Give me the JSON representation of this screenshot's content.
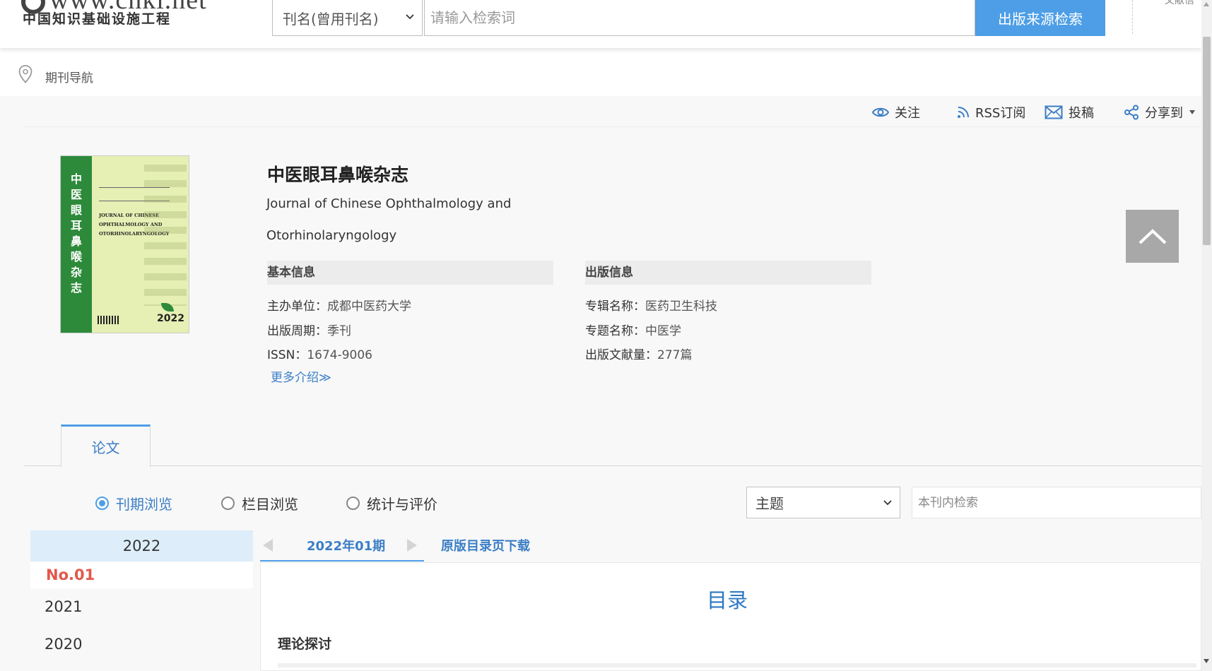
{
  "header": {
    "logo_url": "www.cnki.net",
    "logo_cn": "中国知识基础设施工程",
    "search_select": "刊名(曾用刊名)",
    "search_placeholder": "请输入检索词",
    "search_button": "出版来源检索",
    "right_text": "文献信"
  },
  "breadcrumb": {
    "label": "期刊导航"
  },
  "actions": {
    "follow": "关注",
    "rss": "RSS订阅",
    "submit": "投稿",
    "share": "分享到"
  },
  "journal": {
    "title_cn": "中医眼耳鼻喉杂志",
    "title_en": "Journal of Chinese Ophthalmology and Otorhinolaryngology",
    "cover": {
      "spine_text": "中医眼耳鼻喉杂志",
      "en_text": "JOURNAL OF CHINESE OPHTHALMOLOGY AND OTORHINOLARYNGOLOGY",
      "year": "2022"
    },
    "basic_info": {
      "heading": "基本信息",
      "rows": [
        {
          "key": "主办单位：",
          "value": "成都中医药大学"
        },
        {
          "key": "出版周期：",
          "value": "季刊"
        },
        {
          "key": "ISSN：",
          "value": "1674-9006"
        }
      ]
    },
    "pub_info": {
      "heading": "出版信息",
      "rows": [
        {
          "key": "专辑名称：",
          "value": "医药卫生科技"
        },
        {
          "key": "专题名称：",
          "value": "中医学"
        },
        {
          "key": "出版文献量：",
          "value": "277篇"
        }
      ]
    },
    "more_link": "更多介绍≫"
  },
  "tabs": {
    "active": "论文"
  },
  "browse": {
    "options": [
      "刊期浏览",
      "栏目浏览",
      "统计与评价"
    ],
    "selected": "刊期浏览",
    "filter_select": "主题",
    "inner_search_placeholder": "本刊内检索"
  },
  "years": {
    "current": "2022",
    "current_issue": "No.01",
    "others": [
      "2021",
      "2020"
    ]
  },
  "issue": {
    "label": "2022年01期",
    "download": "原版目录页下载"
  },
  "toc": {
    "title": "目录",
    "first_section": "理论探讨"
  },
  "colors": {
    "accent": "#4d9ee6",
    "link": "#3b7ec6",
    "issue_red": "#e2574c"
  }
}
